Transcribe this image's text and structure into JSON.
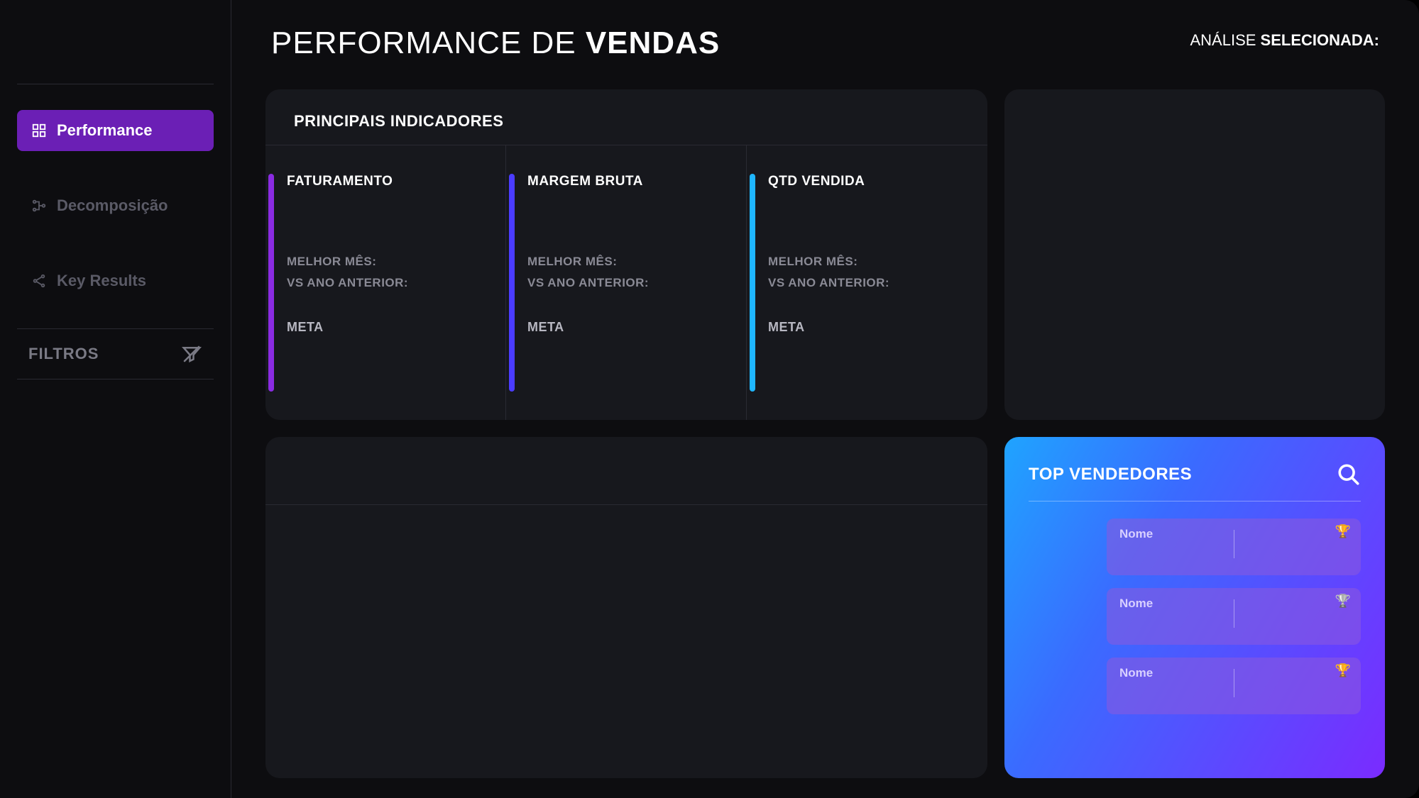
{
  "colors": {
    "accent_purple": "#6b1fb5",
    "bar_violet": "#8a2be2",
    "bar_indigo": "#4b3cff",
    "bar_cyan": "#1fb6ff"
  },
  "sidebar": {
    "items": [
      {
        "label": "Performance",
        "icon": "dashboard-icon",
        "active": true
      },
      {
        "label": "Decomposição",
        "icon": "tree-icon",
        "active": false
      },
      {
        "label": "Key Results",
        "icon": "share-icon",
        "active": false
      }
    ],
    "filters_label": "FILTROS"
  },
  "header": {
    "title_prefix": "PERFORMANCE DE ",
    "title_bold": "VENDAS",
    "analysis_prefix": "ANÁLISE ",
    "analysis_bold": "SELECIONADA:"
  },
  "kpi": {
    "section_title": "PRINCIPAIS INDICADORES",
    "columns": [
      {
        "title": "FATURAMENTO",
        "best_month_label": "MELHOR MÊS:",
        "vs_prev_label": "VS ANO ANTERIOR:",
        "meta_label": "META",
        "bar_color": "#8a2be2"
      },
      {
        "title": "MARGEM BRUTA",
        "best_month_label": "MELHOR MÊS:",
        "vs_prev_label": "VS ANO ANTERIOR:",
        "meta_label": "META",
        "bar_color": "#4b3cff"
      },
      {
        "title": "QTD VENDIDA",
        "best_month_label": "MELHOR MÊS:",
        "vs_prev_label": "VS ANO ANTERIOR:",
        "meta_label": "META",
        "bar_color": "#1fb6ff"
      }
    ]
  },
  "top_vendors": {
    "title": "TOP VENDEDORES",
    "items": [
      {
        "name_label": "Nome",
        "trophy": "🏆"
      },
      {
        "name_label": "Nome",
        "trophy": "🏆"
      },
      {
        "name_label": "Nome",
        "trophy": "🏆"
      }
    ],
    "trophy_colors": [
      "#f5c542",
      "#d0d0d0",
      "#f5c542"
    ]
  }
}
